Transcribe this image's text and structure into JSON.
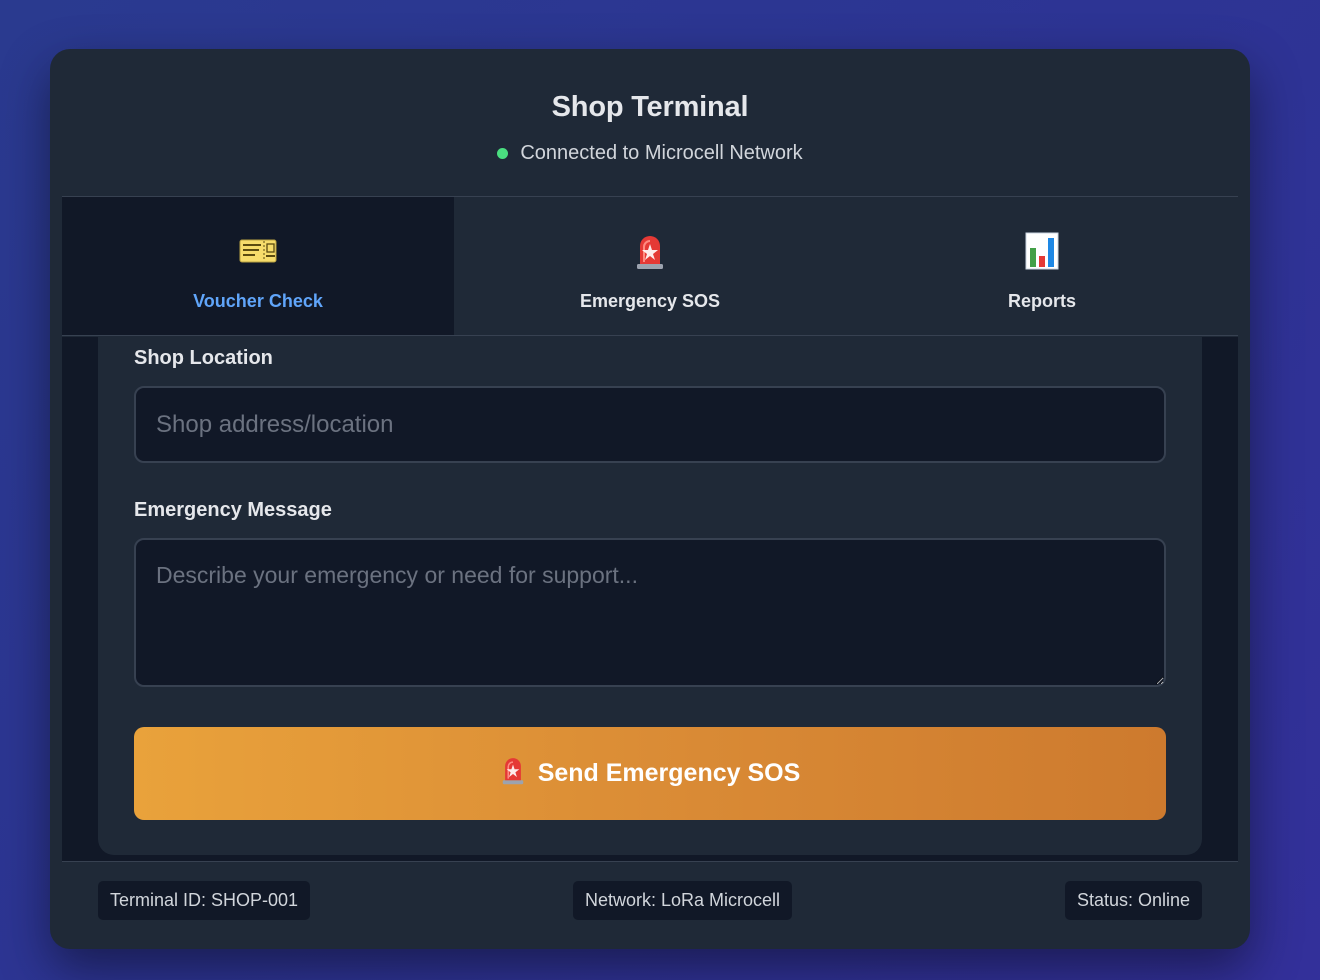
{
  "header": {
    "title": "Shop Terminal",
    "connection_text": "Connected to Microcell Network",
    "status_color": "#4ade80"
  },
  "tabs": [
    {
      "label": "Voucher Check",
      "icon": "ticket-icon",
      "active": true
    },
    {
      "label": "Emergency SOS",
      "icon": "siren-icon",
      "active": false
    },
    {
      "label": "Reports",
      "icon": "bar-chart-icon",
      "active": false
    }
  ],
  "form": {
    "location_label": "Shop Location",
    "location_placeholder": "Shop address/location",
    "location_value": "",
    "message_label": "Emergency Message",
    "message_placeholder": "Describe your emergency or need for support...",
    "message_value": "",
    "submit_label": "Send Emergency SOS",
    "submit_icon": "siren-icon"
  },
  "footer": {
    "terminal_id": "Terminal ID: SHOP-001",
    "network": "Network: LoRa Microcell",
    "status": "Status: Online"
  },
  "colors": {
    "accent": "#60a5fa",
    "sos_gradient_start": "#e9a23b",
    "sos_gradient_end": "#cd7a2e",
    "card_bg": "#1f2937"
  }
}
